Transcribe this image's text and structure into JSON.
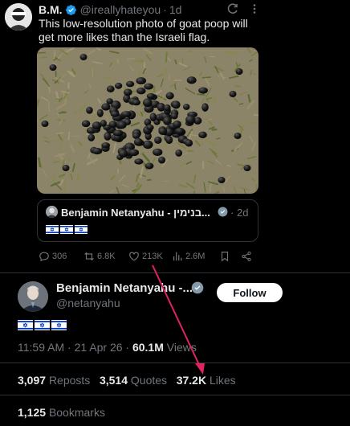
{
  "top_tweet": {
    "author_name": "B.M.",
    "handle": "@ireallyhateyou",
    "separator": "·",
    "time": "1d",
    "text": "This low-resolution photo of goat poop will get more likes than the Israeli flag.",
    "photo_icon": "goat-droppings-photo",
    "quoted": {
      "author_name": "Benjamin Netanyahu - בנימין...",
      "separator": "·",
      "time": "2d",
      "flags": [
        "🇮🇱",
        "🇮🇱",
        "🇮🇱"
      ]
    },
    "actions": {
      "replies": "306",
      "reposts": "6.8K",
      "likes": "213K",
      "views": "2.6M"
    }
  },
  "main_tweet": {
    "author_name": "Benjamin Netanyahu -...",
    "handle": "@netanyahu",
    "follow_label": "Follow",
    "flags": [
      "🇮🇱",
      "🇮🇱",
      "🇮🇱"
    ],
    "time": "11:59 AM",
    "separator": "·",
    "date": "21 Apr 26",
    "views_count": "60.1M",
    "views_label": "Views",
    "reposts_count": "3,097",
    "reposts_label": "Reposts",
    "quotes_count": "3,514",
    "quotes_label": "Quotes",
    "likes_count": "37.2K",
    "likes_label": "Likes",
    "bookmarks_count": "1,125",
    "bookmarks_label": "Bookmarks"
  },
  "colors": {
    "background": "#000000",
    "text": "#e7e9ea",
    "muted": "#71767b",
    "verified": "#1d9bf0",
    "divider": "#2f3336",
    "annotation_arrow": "#e0245e"
  }
}
